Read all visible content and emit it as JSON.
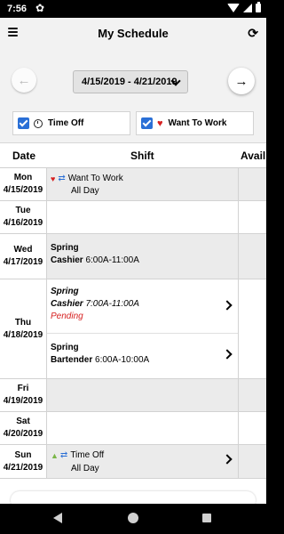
{
  "status_bar": {
    "time": "7:56",
    "icons": [
      "gear-icon",
      "wifi-icon",
      "signal-icon",
      "battery-icon"
    ]
  },
  "header": {
    "title": "My Schedule",
    "menu_icon": "hamburger-icon",
    "refresh_icon": "refresh-icon"
  },
  "week_nav": {
    "date_range": "4/15/2019 - 4/21/2019",
    "prev_icon": "arrow-left-icon",
    "next_icon": "arrow-right-icon"
  },
  "filters": {
    "time_off": {
      "label": "Time Off",
      "checked": true,
      "icon": "clock-icon"
    },
    "want_to_work": {
      "label": "Want To Work",
      "checked": true,
      "icon": "heart-icon"
    }
  },
  "table": {
    "headers": {
      "date": "Date",
      "shift": "Shift",
      "avail": "Avail"
    },
    "rows": [
      {
        "day": "Mon",
        "date": "4/15/2019",
        "entries": [
          {
            "type": "want",
            "label": "Want To Work",
            "detail": "All Day"
          }
        ]
      },
      {
        "day": "Tue",
        "date": "4/16/2019",
        "entries": []
      },
      {
        "day": "Wed",
        "date": "4/17/2019",
        "entries": [
          {
            "type": "shift",
            "location": "Spring",
            "role": "Cashier",
            "time": "6:00A-11:00A"
          }
        ]
      },
      {
        "day": "Thu",
        "date": "4/18/2019",
        "entries": [
          {
            "type": "shift",
            "location": "Spring",
            "role": "Cashier",
            "time": "7:00A-11:00A",
            "status": "Pending"
          },
          {
            "type": "shift",
            "location": "Spring",
            "role": "Bartender",
            "time": "6:00A-10:00A"
          }
        ]
      },
      {
        "day": "Fri",
        "date": "4/19/2019",
        "entries": []
      },
      {
        "day": "Sat",
        "date": "4/20/2019",
        "entries": []
      },
      {
        "day": "Sun",
        "date": "4/21/2019",
        "entries": [
          {
            "type": "timeoff",
            "label": "Time Off",
            "detail": "All Day"
          }
        ]
      }
    ]
  },
  "colors": {
    "accent_blue": "#2a6fd6",
    "heart_red": "#d62020",
    "pending_red": "#d62020",
    "thumb_green": "#7ab648"
  }
}
